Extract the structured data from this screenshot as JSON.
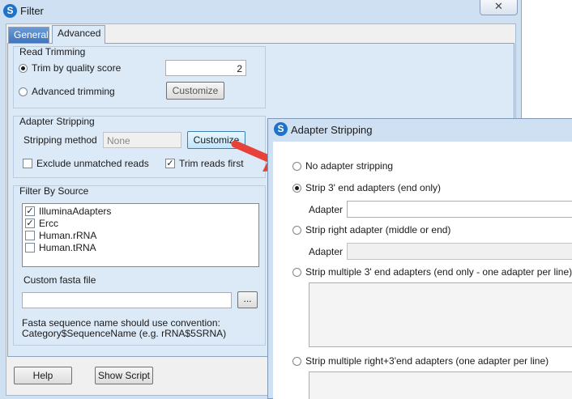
{
  "window": {
    "title": "Filter",
    "close": "✕"
  },
  "tabs": {
    "general": "General",
    "advanced": "Advanced"
  },
  "read_trimming": {
    "title": "Read Trimming",
    "trim_quality_label": "Trim by quality score",
    "quality_value": "2",
    "advanced_label": "Advanced trimming",
    "customize": "Customize"
  },
  "adapter_stripping": {
    "title": "Adapter Stripping",
    "method_label": "Stripping method",
    "method_value": "None",
    "customize": "Customize",
    "exclude_label": "Exclude unmatched reads",
    "trim_first_label": "Trim reads first",
    "trim_first_checked": "✓"
  },
  "filter_by_source": {
    "title": "Filter By Source",
    "items": [
      {
        "label": "IlluminaAdapters",
        "mark": "✓"
      },
      {
        "label": "Ercc",
        "mark": "✓"
      },
      {
        "label": "Human.rRNA",
        "mark": ""
      },
      {
        "label": "Human.tRNA",
        "mark": ""
      }
    ],
    "custom_fasta_label": "Custom fasta file",
    "browse": "...",
    "hint_line1": "Fasta sequence name should use convention:",
    "hint_line2": "Category$SequenceName (e.g. rRNA$5SRNA)"
  },
  "footer": {
    "help": "Help",
    "show_script": "Show Script"
  },
  "dialog": {
    "title": "Adapter Stripping",
    "options": {
      "none": "No adapter stripping",
      "strip3": "Strip 3' end adapters (end only)",
      "right": "Strip right adapter (middle or end)",
      "multi3": "Strip multiple 3' end adapters (end only - one adapter per line)",
      "multi_right": "Strip multiple right+3'end adapters (one adapter per line)"
    },
    "adapter_label": "Adapter"
  },
  "colors": {
    "arrow": "#e8413a",
    "tab_active": "#3f74bf",
    "panel": "#dce9f7"
  }
}
